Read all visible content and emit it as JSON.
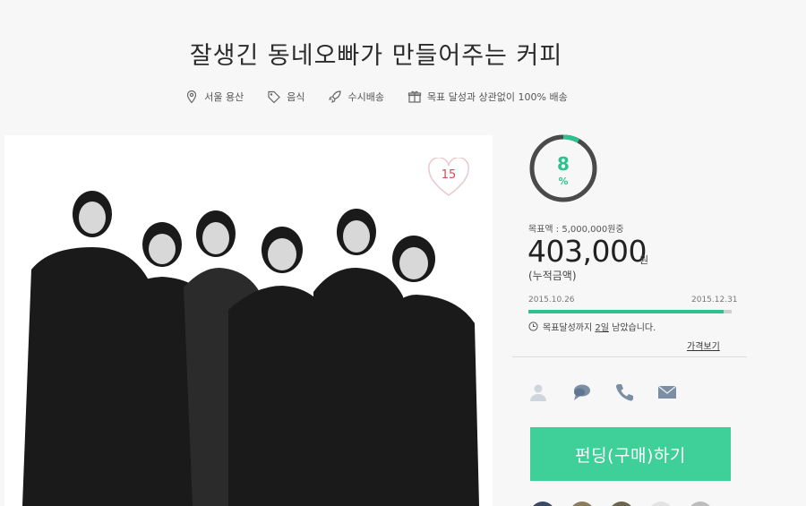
{
  "page": {
    "title": "잘생긴 동네오빠가 만들어주는 커피"
  },
  "tags": [
    {
      "icon": "location-pin-icon",
      "label": "서울 용산"
    },
    {
      "icon": "price-tag-icon",
      "label": "음식"
    },
    {
      "icon": "rocket-icon",
      "label": "수시배송"
    },
    {
      "icon": "gift-icon",
      "label": "목표 달성과 상관없이 100% 배송"
    }
  ],
  "photo": {
    "like_count": "15"
  },
  "progress": {
    "percent_value": "8",
    "percent_sign": "%",
    "fraction": 0.08
  },
  "funding": {
    "goal_label": "목표액 : 5,000,000원중",
    "amount": "403,000",
    "currency": "원",
    "accumulated_label": "(누적금액)",
    "start_date": "2015.10.26",
    "end_date": "2015.12.31",
    "timeline_fraction": 0.96,
    "remain_prefix": "목표달성까지 ",
    "remain_days": "2일",
    "remain_suffix": " 남았습니다.",
    "price_link": "가격보기"
  },
  "contact_icons": [
    "person-icon",
    "chat-bubble-icon",
    "phone-icon",
    "mail-icon"
  ],
  "cta": {
    "label": "펀딩(구매)하기"
  },
  "colors": {
    "accent": "#3fcf98",
    "ring_track": "#4a4a4a",
    "like": "#d14a5a"
  }
}
